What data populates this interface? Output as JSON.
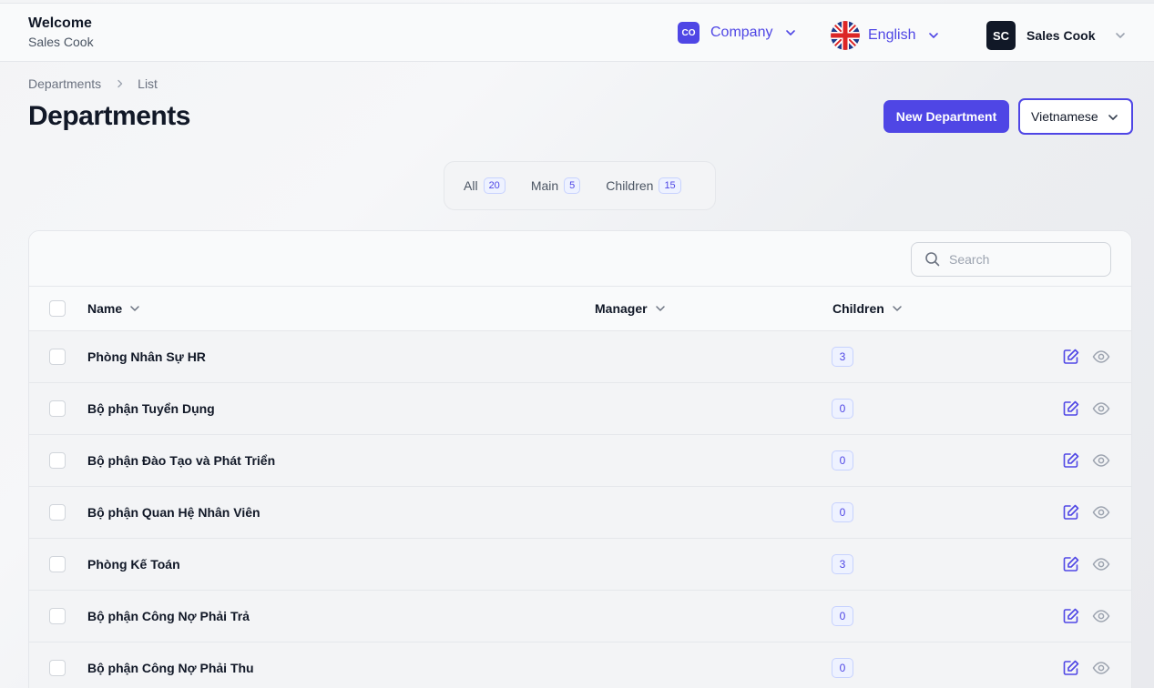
{
  "header": {
    "welcome": "Welcome",
    "user_sub": "Sales Cook",
    "company": {
      "initials": "CO",
      "label": "Company"
    },
    "language": {
      "label": "English"
    },
    "user": {
      "initials": "SC",
      "name": "Sales Cook"
    }
  },
  "breadcrumb": {
    "parent": "Departments",
    "current": "List"
  },
  "page": {
    "title": "Departments",
    "new_button": "New Department",
    "locale_select": "Vietnamese"
  },
  "tabs": [
    {
      "label": "All",
      "count": "20"
    },
    {
      "label": "Main",
      "count": "5"
    },
    {
      "label": "Children",
      "count": "15"
    }
  ],
  "search": {
    "placeholder": "Search"
  },
  "table": {
    "columns": {
      "name": "Name",
      "manager": "Manager",
      "children": "Children"
    },
    "rows": [
      {
        "name": "Phòng Nhân Sự HR",
        "manager": "",
        "children": "3"
      },
      {
        "name": "Bộ phận Tuyển Dụng",
        "manager": "",
        "children": "0"
      },
      {
        "name": "Bộ phận Đào Tạo và Phát Triển",
        "manager": "",
        "children": "0"
      },
      {
        "name": "Bộ phận Quan Hệ Nhân Viên",
        "manager": "",
        "children": "0"
      },
      {
        "name": "Phòng Kế Toán",
        "manager": "",
        "children": "3"
      },
      {
        "name": "Bộ phận Công Nợ Phải Trả",
        "manager": "",
        "children": "0"
      },
      {
        "name": "Bộ phận Công Nợ Phải Thu",
        "manager": "",
        "children": "0"
      }
    ]
  },
  "colors": {
    "accent": "#4f46e5",
    "text": "#111827",
    "muted": "#6b7280"
  },
  "icons": {
    "chevron": "chevron-down-icon",
    "search": "search-icon",
    "edit": "edit-icon",
    "view": "eye-icon",
    "flag": "uk-flag-icon"
  }
}
